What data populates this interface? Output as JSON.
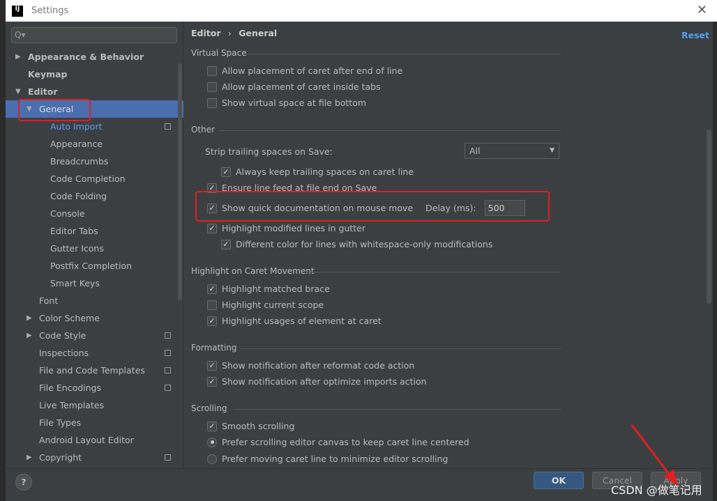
{
  "window": {
    "title": "Settings",
    "logo": "IJ",
    "close_icon": "close-icon"
  },
  "search": {
    "placeholder": "Q▾"
  },
  "tree": [
    {
      "label": "Appearance & Behavior",
      "level": 0,
      "bold": true,
      "arrow": "right"
    },
    {
      "label": "Keymap",
      "level": 0,
      "bold": true
    },
    {
      "label": "Editor",
      "level": 0,
      "bold": true,
      "arrow": "down"
    },
    {
      "label": "General",
      "level": 1,
      "arrow": "down",
      "selected": true
    },
    {
      "label": "Auto Import",
      "level": 2,
      "link": true,
      "copy": true
    },
    {
      "label": "Appearance",
      "level": 2
    },
    {
      "label": "Breadcrumbs",
      "level": 2
    },
    {
      "label": "Code Completion",
      "level": 2
    },
    {
      "label": "Code Folding",
      "level": 2
    },
    {
      "label": "Console",
      "level": 2
    },
    {
      "label": "Editor Tabs",
      "level": 2
    },
    {
      "label": "Gutter Icons",
      "level": 2
    },
    {
      "label": "Postfix Completion",
      "level": 2
    },
    {
      "label": "Smart Keys",
      "level": 2
    },
    {
      "label": "Font",
      "level": 1
    },
    {
      "label": "Color Scheme",
      "level": 1,
      "arrow": "right"
    },
    {
      "label": "Code Style",
      "level": 1,
      "arrow": "right",
      "copy": true
    },
    {
      "label": "Inspections",
      "level": 1,
      "copy": true
    },
    {
      "label": "File and Code Templates",
      "level": 1,
      "copy": true
    },
    {
      "label": "File Encodings",
      "level": 1,
      "copy": true
    },
    {
      "label": "Live Templates",
      "level": 1
    },
    {
      "label": "File Types",
      "level": 1
    },
    {
      "label": "Android Layout Editor",
      "level": 1
    },
    {
      "label": "Copyright",
      "level": 1,
      "arrow": "right",
      "copy": true
    }
  ],
  "breadcrumb": {
    "parent": "Editor",
    "sep": "›",
    "current": "General"
  },
  "reset": "Reset",
  "sections": {
    "virtual_space": "Virtual Space",
    "other": "Other",
    "caret": "Highlight on Caret Movement",
    "formatting": "Formatting",
    "scrolling": "Scrolling"
  },
  "options": {
    "vs1": {
      "label": "Allow placement of caret after end of line",
      "checked": false
    },
    "vs2": {
      "label": "Allow placement of caret inside tabs",
      "checked": false
    },
    "vs3": {
      "label": "Show virtual space at file bottom",
      "checked": false
    },
    "strip_label": "Strip trailing spaces on Save:",
    "strip_value": "All",
    "o1": {
      "label": "Always keep trailing spaces on caret line",
      "checked": true
    },
    "o2": {
      "label": "Ensure line feed at file end on Save",
      "checked": true
    },
    "o3": {
      "label": "Show quick documentation on mouse move",
      "checked": true
    },
    "delay_label": "Delay (ms):",
    "delay_value": "500",
    "o4": {
      "label": "Highlight modified lines in gutter",
      "checked": true
    },
    "o5": {
      "label": "Different color for lines with whitespace-only modifications",
      "checked": true
    },
    "c1": {
      "label": "Highlight matched brace",
      "checked": true
    },
    "c2": {
      "label": "Highlight current scope",
      "checked": false
    },
    "c3": {
      "label": "Highlight usages of element at caret",
      "checked": true
    },
    "f1": {
      "label": "Show notification after reformat code action",
      "checked": true
    },
    "f2": {
      "label": "Show notification after optimize imports action",
      "checked": true
    },
    "s1": {
      "label": "Smooth scrolling",
      "checked": true
    },
    "s2": {
      "label": "Prefer scrolling editor canvas to keep caret line centered",
      "selected": true
    },
    "s3": {
      "label": "Prefer moving caret line to minimize editor scrolling",
      "selected": false
    }
  },
  "footer": {
    "help": "?",
    "ok": "OK",
    "cancel": "Cancel",
    "apply": "Apply"
  },
  "watermark": "CSDN @做笔记用",
  "annotation_color": "#e02020"
}
